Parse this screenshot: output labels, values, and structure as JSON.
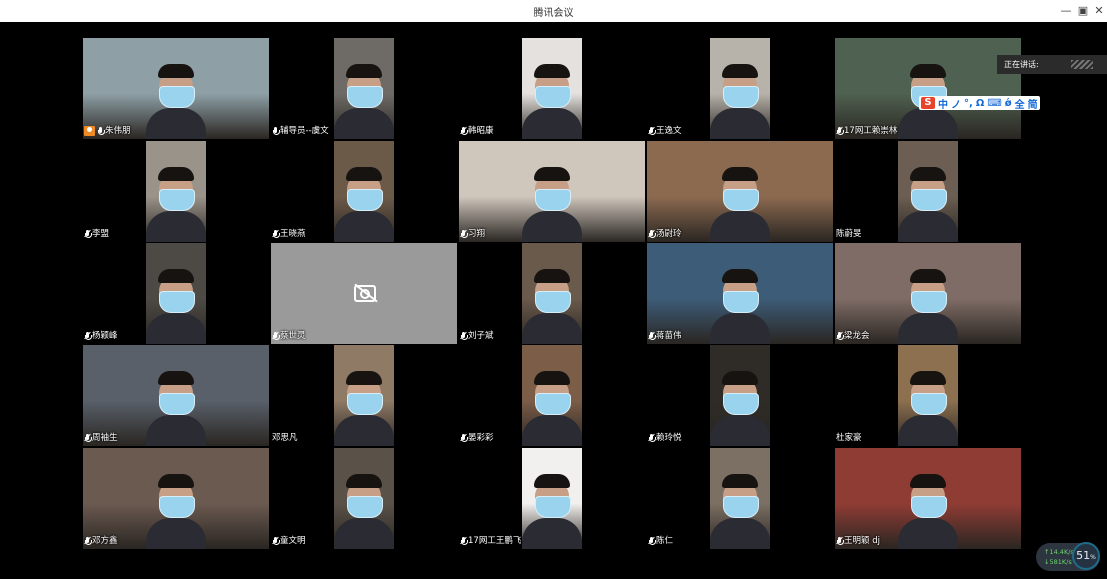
{
  "window": {
    "title": "腾讯会议",
    "minimize_icon": "minimize-icon",
    "restore_icon": "restore-icon",
    "close_icon": "close-icon"
  },
  "speaking_indicator": {
    "label": "正在讲话:"
  },
  "ime_toolbar": {
    "logo": "S",
    "items": [
      "中",
      "ノ",
      "°,",
      "Ω",
      "⌨",
      "ǿ",
      "全",
      "简"
    ]
  },
  "participants": [
    {
      "name": "朱伟朋",
      "mic": "on",
      "host": true,
      "camera": "on",
      "bg": "#8ea0a6"
    },
    {
      "name": "辅导员--虞文",
      "mic": "on",
      "host": false,
      "camera": "on",
      "bg": "#6e6a66"
    },
    {
      "name": "韩昭康",
      "mic": "muted",
      "host": false,
      "camera": "on",
      "bg": "#e4e1de"
    },
    {
      "name": "王逸文",
      "mic": "muted",
      "host": false,
      "camera": "on",
      "bg": "#b7b2aa"
    },
    {
      "name": "17网工赖崇林",
      "mic": "muted",
      "host": false,
      "camera": "on",
      "bg": "#4f6150"
    },
    {
      "name": "李盟",
      "mic": "muted",
      "host": false,
      "camera": "on",
      "bg": "#9a938a"
    },
    {
      "name": "王晓燕",
      "mic": "muted",
      "host": false,
      "camera": "on",
      "bg": "#6c5a49"
    },
    {
      "name": "习翔",
      "mic": "muted",
      "host": false,
      "camera": "on",
      "bg": "#cfc6bc"
    },
    {
      "name": "汤尉玲",
      "mic": "muted",
      "host": false,
      "camera": "on",
      "bg": "#8c6a50"
    },
    {
      "name": "陈蔚旻",
      "mic": "none",
      "host": false,
      "camera": "on",
      "bg": "#6c5e52"
    },
    {
      "name": "杨颖峰",
      "mic": "muted",
      "host": false,
      "camera": "on",
      "bg": "#4d4a45"
    },
    {
      "name": "蔡世灵",
      "mic": "muted",
      "host": false,
      "camera": "off",
      "bg": "#9a9a9a"
    },
    {
      "name": "刘子斌",
      "mic": "muted",
      "host": false,
      "camera": "on",
      "bg": "#6a5a4c"
    },
    {
      "name": "蒋苗伟",
      "mic": "muted",
      "host": false,
      "camera": "on",
      "bg": "#3d5c78"
    },
    {
      "name": "梁龙会",
      "mic": "muted",
      "host": false,
      "camera": "on",
      "bg": "#7f6c66"
    },
    {
      "name": "周袖生",
      "mic": "muted",
      "host": false,
      "camera": "on",
      "bg": "#59606a"
    },
    {
      "name": "邓思凡",
      "mic": "none",
      "host": false,
      "camera": "on",
      "bg": "#8f7a66"
    },
    {
      "name": "晏彩彩",
      "mic": "muted",
      "host": false,
      "camera": "on",
      "bg": "#7b5d48"
    },
    {
      "name": "赖玲悦",
      "mic": "muted",
      "host": false,
      "camera": "on",
      "bg": "#2f2b27"
    },
    {
      "name": "杜家豪",
      "mic": "none",
      "host": false,
      "camera": "on",
      "bg": "#8c7050"
    },
    {
      "name": "邓方鑫",
      "mic": "muted",
      "host": false,
      "camera": "on",
      "bg": "#6b5a50"
    },
    {
      "name": "童文明",
      "mic": "muted",
      "host": false,
      "camera": "on",
      "bg": "#5a5248"
    },
    {
      "name": "17网工王鹏飞",
      "mic": "muted",
      "host": false,
      "camera": "on",
      "bg": "#f2f0ee"
    },
    {
      "name": "陈仁",
      "mic": "muted",
      "host": false,
      "camera": "on",
      "bg": "#7c6f63"
    },
    {
      "name": "王明颖 dj",
      "mic": "muted",
      "host": false,
      "camera": "on",
      "bg": "#8f3c34"
    }
  ],
  "network": {
    "upload": "14.4",
    "upload_unit": "K/s",
    "download": "581",
    "download_unit": "K/s",
    "usage_value": "51",
    "usage_unit": "%"
  }
}
